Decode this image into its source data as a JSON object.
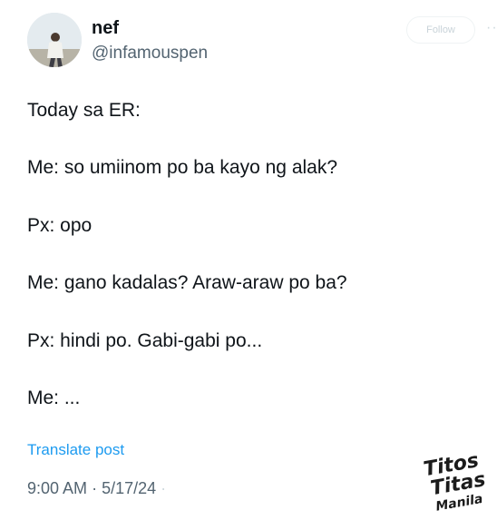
{
  "author": {
    "name": "nef",
    "handle": "@infamouspen"
  },
  "actions": {
    "follow_label": "Follow",
    "more_icon": "more-horizontal-icon"
  },
  "post": {
    "lines": [
      "Today sa ER:",
      "Me: so umiinom po ba kayo ng alak?",
      "Px: opo",
      "Me: gano kadalas? Araw-araw po ba?",
      "Px: hindi po. Gabi-gabi po...",
      "Me: ..."
    ],
    "translate_label": "Translate post",
    "time": "9:00 AM",
    "separator": "·",
    "date": "5/17/24",
    "trailing_separator": "·"
  },
  "watermark": {
    "text": [
      "Titos",
      "Titas",
      "Manila"
    ]
  },
  "colors": {
    "text": "#0f1419",
    "secondary": "#536471",
    "link": "#1d9bf0"
  }
}
